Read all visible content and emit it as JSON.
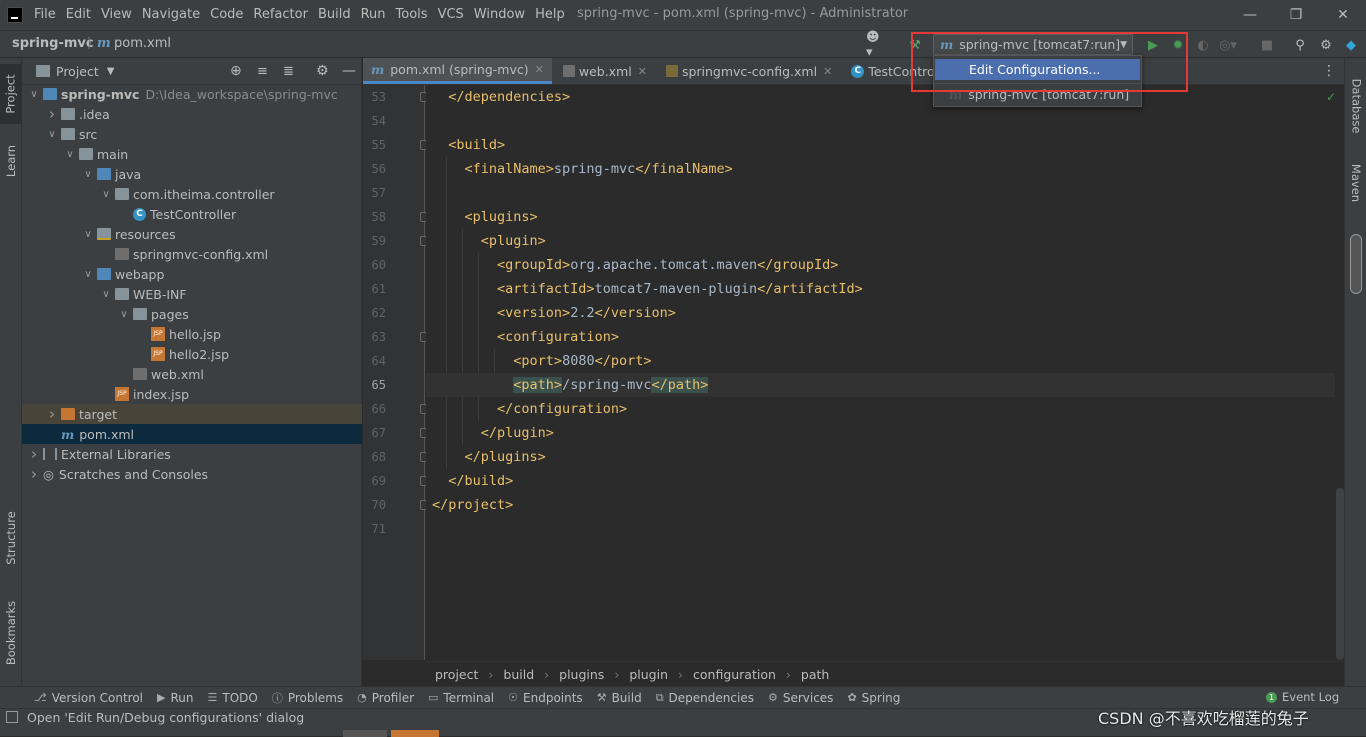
{
  "menu": {
    "items": [
      "File",
      "Edit",
      "View",
      "Navigate",
      "Code",
      "Refactor",
      "Build",
      "Run",
      "Tools",
      "VCS",
      "Window",
      "Help"
    ],
    "window_title": "spring-mvc - pom.xml (spring-mvc) - Administrator"
  },
  "nav": {
    "project": "spring-mvc",
    "file": "pom.xml",
    "run_config": "spring-mvc [tomcat7:run]"
  },
  "run_dropdown": {
    "edit": "Edit Configurations...",
    "config": "spring-mvc [tomcat7:run]"
  },
  "project_panel": {
    "title": "Project",
    "tree": [
      {
        "label": "spring-mvc",
        "path": "D:\\Idea_workspace\\spring-mvc"
      },
      {
        "label": ".idea"
      },
      {
        "label": "src"
      },
      {
        "label": "main"
      },
      {
        "label": "java"
      },
      {
        "label": "com.itheima.controller"
      },
      {
        "label": "TestController"
      },
      {
        "label": "resources"
      },
      {
        "label": "springmvc-config.xml"
      },
      {
        "label": "webapp"
      },
      {
        "label": "WEB-INF"
      },
      {
        "label": "pages"
      },
      {
        "label": "hello.jsp"
      },
      {
        "label": "hello2.jsp"
      },
      {
        "label": "web.xml"
      },
      {
        "label": "index.jsp"
      },
      {
        "label": "target"
      },
      {
        "label": "pom.xml"
      },
      {
        "label": "External Libraries"
      },
      {
        "label": "Scratches and Consoles"
      }
    ]
  },
  "side_tabs": {
    "left": [
      "Project",
      "Learn",
      "Structure",
      "Bookmarks"
    ],
    "right": [
      "Database",
      "Maven"
    ]
  },
  "editor_tabs": [
    "pom.xml (spring-mvc)",
    "web.xml",
    "springmvc-config.xml",
    "TestController.ja"
  ],
  "editor": {
    "current_line": 65,
    "lines": [
      {
        "n": "53",
        "code": "  </dependencies>"
      },
      {
        "n": "54",
        "code": ""
      },
      {
        "n": "55",
        "code": "  <build>"
      },
      {
        "n": "56",
        "code": "    <finalName>spring-mvc</finalName>"
      },
      {
        "n": "57",
        "code": ""
      },
      {
        "n": "58",
        "code": "    <plugins>"
      },
      {
        "n": "59",
        "code": "      <plugin>"
      },
      {
        "n": "60",
        "code": "        <groupId>org.apache.tomcat.maven</groupId>"
      },
      {
        "n": "61",
        "code": "        <artifactId>tomcat7-maven-plugin</artifactId>"
      },
      {
        "n": "62",
        "code": "        <version>2.2</version>"
      },
      {
        "n": "63",
        "code": "        <configuration>"
      },
      {
        "n": "64",
        "code": "          <port>8080</port>"
      },
      {
        "n": "65",
        "code": "          <path>/spring-mvc</path>"
      },
      {
        "n": "66",
        "code": "        </configuration>"
      },
      {
        "n": "67",
        "code": "      </plugin>"
      },
      {
        "n": "68",
        "code": "    </plugins>"
      },
      {
        "n": "69",
        "code": "  </build>"
      },
      {
        "n": "70",
        "code": "</project>"
      },
      {
        "n": "71",
        "code": ""
      }
    ],
    "breadcrumbs": [
      "project",
      "build",
      "plugins",
      "plugin",
      "configuration",
      "path"
    ]
  },
  "bottom_tabs": [
    "Version Control",
    "Run",
    "TODO",
    "Problems",
    "Profiler",
    "Terminal",
    "Endpoints",
    "Build",
    "Dependencies",
    "Services",
    "Spring"
  ],
  "event_log": "Event Log",
  "status": "Open 'Edit Run/Debug configurations' dialog",
  "watermark": "CSDN @不喜欢吃榴莲的兔子",
  "colors": {
    "accent": "#4b6eaf",
    "highlight_box": "#e53935",
    "tag": "#e8bf6a",
    "text": "#a9b7c6"
  }
}
